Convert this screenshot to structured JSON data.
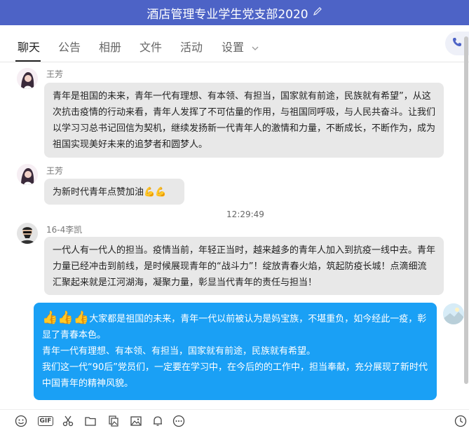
{
  "window": {
    "title": "酒店管理专业学生党支部2020"
  },
  "tabs": [
    {
      "label": "聊天"
    },
    {
      "label": "公告"
    },
    {
      "label": "相册"
    },
    {
      "label": "文件"
    },
    {
      "label": "活动"
    },
    {
      "label": "设置"
    }
  ],
  "messages": [
    {
      "sender": "王芳",
      "text": "青年是祖国的未来，青年一代有理想、有本领、有担当，国家就有前途，民族就有希望”，从这次抗击疫情的行动来看，青年人发挥了不可估量的作用，与祖国同呼吸，与人民共奋斗。让我们以学习习总书记回信为契机，继续发扬新一代青年人的激情和力量，不断成长，不断作为，成为祖国实现美好未来的追梦者和圆梦人。"
    },
    {
      "sender": "王芳",
      "text": "为新时代青年点赞加油",
      "emoji": "💪💪"
    },
    {
      "time": "12:29:49"
    },
    {
      "sender": "16-4李凯",
      "text": "一代人有一代人的担当。疫情当前，年轻正当时，越来越多的青年人加入到抗疫一线中去。青年力量已经冲击到前线，是时候展现青年的“战斗力”！绽放青春火焰，筑起防疫长城！点滴细流汇聚起来就是江河湖海，凝聚力量，彰显当代青年的责任与担当！"
    },
    {
      "self": true,
      "emoji": "👍👍👍",
      "lines": [
        "大家都是祖国的未来，青年一代以前被认为是妈宝族，不堪重负，如今经此一疫，彰显了青春本色。",
        "青年一代有理想、有本领、有担当，国家就有前途，民族就有希望。",
        "我们这一代“90后”党员们，一定要在学习中，在今后的的工作中，担当奉献，充分展现了新时代中国青年的精神风貌。"
      ]
    }
  ],
  "toolbar": {
    "icons": [
      "emoji-icon",
      "gif-icon",
      "scissors-icon",
      "folder-icon",
      "image-library-icon",
      "picture-icon",
      "bell-icon",
      "more-icon",
      "clock-icon"
    ],
    "gif_label": "GIF"
  },
  "colors": {
    "titlebar": "#4d63c6",
    "self_bubble": "#1aa0f5",
    "other_bubble": "#e8e8e8"
  }
}
